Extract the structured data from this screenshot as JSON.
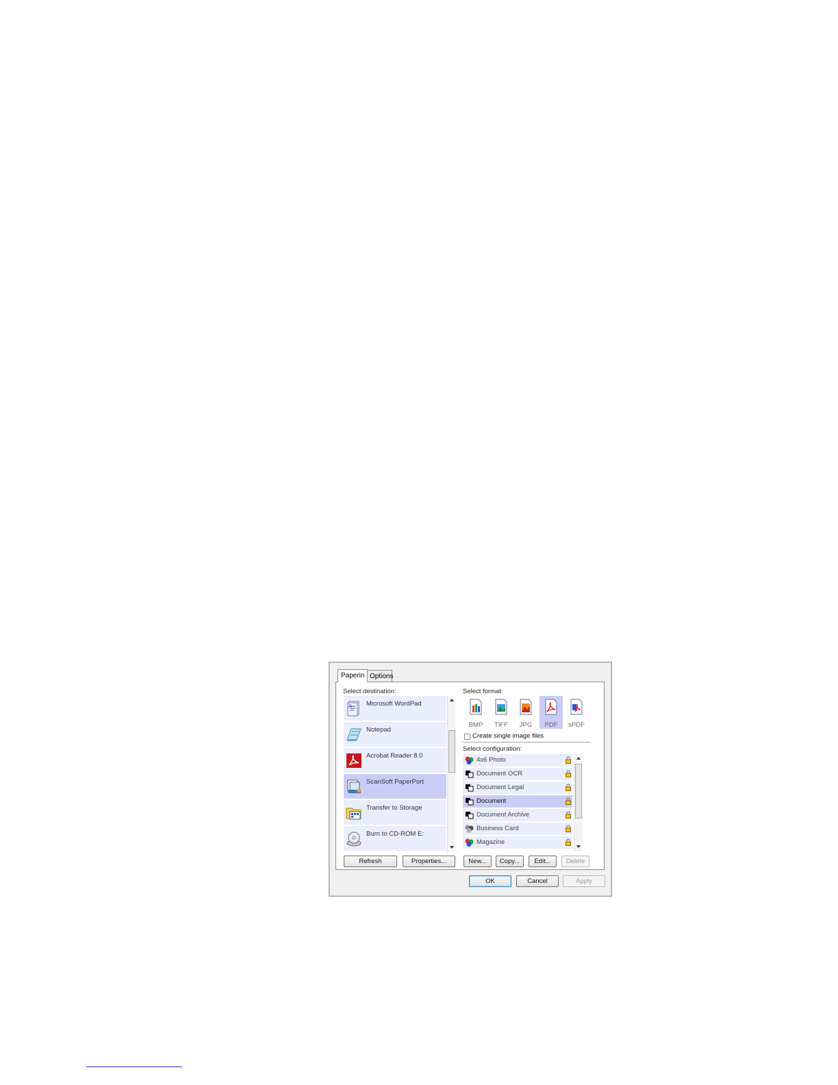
{
  "dialog": {
    "tabs": [
      {
        "label": "Paperin"
      },
      {
        "label": "Options"
      }
    ],
    "destination": {
      "label": "Select destination:",
      "items": [
        {
          "label": "Microsoft WordPad",
          "icon": "wordpad-icon"
        },
        {
          "label": "Notepad",
          "icon": "notepad-icon"
        },
        {
          "label": "Acrobat Reader 8.0",
          "icon": "acrobat-icon"
        },
        {
          "label": "ScanSoft PaperPort",
          "icon": "paperport-icon",
          "selected": true
        },
        {
          "label": "Transfer to Storage",
          "icon": "storage-folder-icon"
        },
        {
          "label": "Burn to CD-ROM  E:",
          "icon": "cd-burn-icon"
        }
      ]
    },
    "format": {
      "label": "Select format:",
      "items": [
        {
          "label": "BMP",
          "icon": "bmp-icon"
        },
        {
          "label": "TIFF",
          "icon": "tiff-icon"
        },
        {
          "label": "JPG",
          "icon": "jpg-icon"
        },
        {
          "label": "PDF",
          "icon": "pdf-icon",
          "selected": true
        },
        {
          "label": "sPDF",
          "icon": "spdf-icon"
        }
      ],
      "single_image_label": "Create single image files",
      "single_image_checked": false
    },
    "configuration": {
      "label": "Select configuration:",
      "items": [
        {
          "label": "4x6 Photo",
          "icon": "color-photo-icon"
        },
        {
          "label": "Document OCR",
          "icon": "bw-document-icon"
        },
        {
          "label": "Document Legal",
          "icon": "bw-document-icon"
        },
        {
          "label": "Document",
          "icon": "bw-document-icon",
          "selected": true
        },
        {
          "label": "Document Archive",
          "icon": "bw-document-icon"
        },
        {
          "label": "Business Card",
          "icon": "gray-card-icon"
        },
        {
          "label": "Magazine",
          "icon": "color-photo-icon"
        }
      ]
    },
    "buttons": {
      "refresh": "Refresh",
      "properties": "Properties...",
      "new": "New...",
      "copy": "Copy...",
      "edit": "Edit...",
      "delete": "Delete",
      "ok": "OK",
      "cancel": "Cancel",
      "apply": "Apply"
    },
    "colors": {
      "item_bg": "#eaedfb",
      "selected_bg": "#c9cdf5"
    }
  }
}
